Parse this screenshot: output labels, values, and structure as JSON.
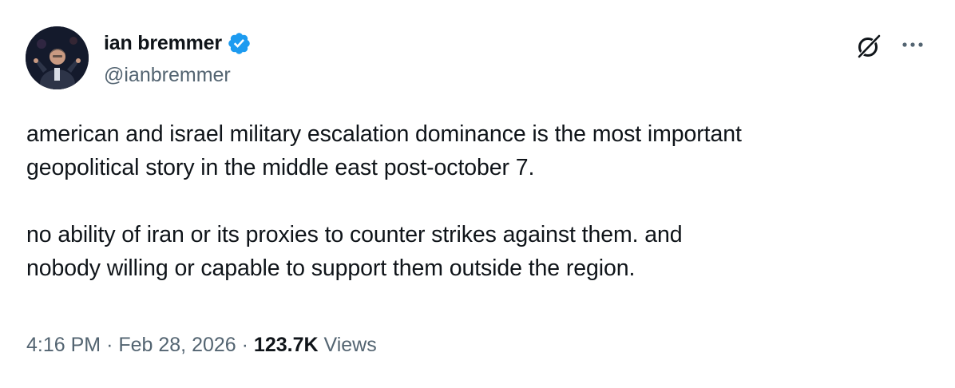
{
  "author": {
    "display_name": "ian bremmer",
    "handle": "@ianbremmer",
    "verified": true
  },
  "icons": {
    "avatar": "avatar-photo",
    "verified": "verified-badge-icon",
    "grok": "grok-icon",
    "more": "more-options-icon"
  },
  "colors": {
    "text": "#0f1419",
    "secondary": "#536471",
    "verified_blue": "#1d9bf0"
  },
  "tweet": {
    "lines": [
      "american and israel military escalation dominance is the most important",
      "geopolitical story in the middle east post-october 7.",
      "no ability of iran or its proxies to counter strikes against them. and",
      "nobody willing or capable to support them outside the region."
    ]
  },
  "meta": {
    "time": "4:16 PM",
    "separator": "·",
    "date": "Feb 28, 2026",
    "views_count": "123.7K",
    "views_label": "Views"
  }
}
